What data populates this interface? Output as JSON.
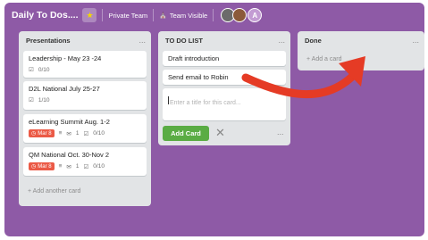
{
  "board": {
    "title": "Daily To Dos....",
    "team": "Private Team",
    "visibility": "Team Visible",
    "avatar_initial": "A"
  },
  "lists": [
    {
      "title": "Presentations",
      "menu": "...",
      "cards": [
        {
          "title": "Leadership - May 23 -24",
          "checklist": "0/10"
        },
        {
          "title": "D2L National July 25-27",
          "checklist": "1/10"
        },
        {
          "title": "eLearning Summit Aug. 1-2",
          "due": "Mar 8",
          "comments": "1",
          "checklist": "0/10"
        },
        {
          "title": "QM National Oct. 30-Nov 2",
          "due": "Mar 8",
          "comments": "1",
          "checklist": "0/10"
        }
      ],
      "add_label": "+ Add another card"
    },
    {
      "title": "TO DO LIST",
      "menu": "...",
      "cards": [
        {
          "title": "Draft introduction"
        },
        {
          "title": "Send email to Robin"
        }
      ],
      "compose_placeholder": "Enter a title for this card...",
      "add_button": "Add Card",
      "cancel": "✕",
      "more": "..."
    },
    {
      "title": "Done",
      "menu": "...",
      "add_label": "+ Add a card"
    }
  ],
  "annotation": {
    "arrow_color": "#e53b25"
  },
  "colors": {
    "board_bg": "#8e5aa6",
    "list_bg": "#e2e4e6",
    "add_green": "#5aac44",
    "due_red": "#eb5a46"
  }
}
